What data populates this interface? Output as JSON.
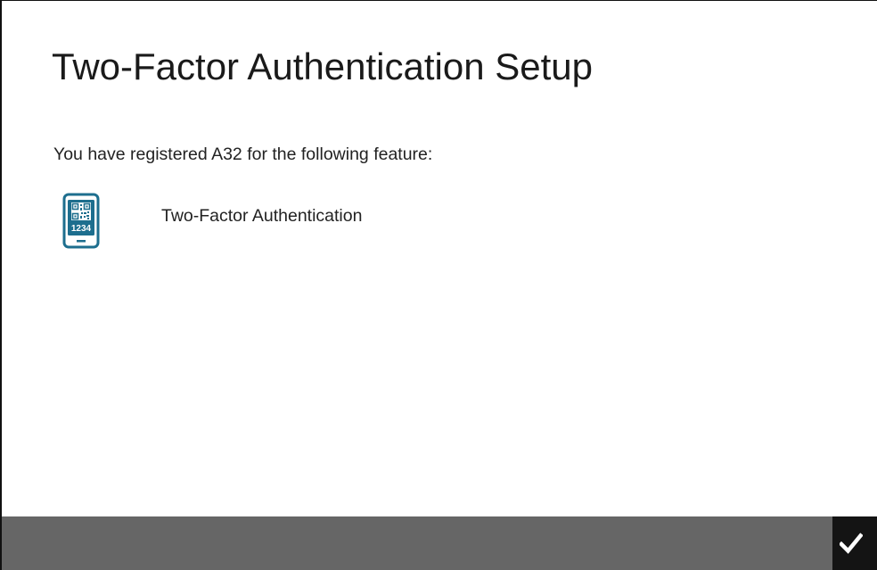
{
  "page": {
    "title": "Two-Factor Authentication Setup",
    "intro": "You have registered A32 for the following feature:"
  },
  "features": [
    {
      "icon": "phone-qr-code-icon",
      "icon_text": "1234",
      "label": "Two-Factor Authentication"
    }
  ],
  "footer": {
    "confirm_icon": "checkmark-icon"
  },
  "colors": {
    "background": "#ffffff",
    "text": "#222222",
    "icon_accent": "#1d6e8e",
    "footer_bar": "#666666",
    "confirm_button": "#141414",
    "confirm_icon": "#ffffff"
  }
}
